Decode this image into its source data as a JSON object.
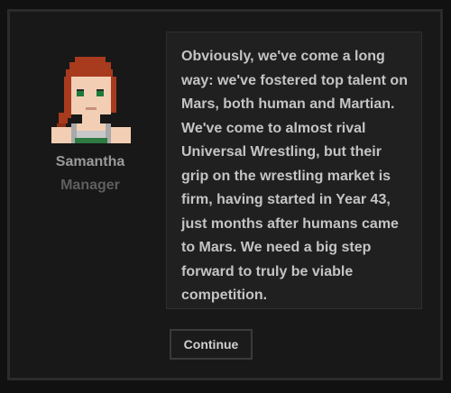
{
  "speaker": {
    "name": "Samantha",
    "role": "Manager",
    "portrait_icon": "pixel-portrait-icon"
  },
  "dialogue": {
    "text": "Obviously, we've come a long way: we've fostered top talent on Mars, both human and Martian. We've come to almost rival Universal Wrestling, but their grip on the wrestling market is firm, having started in Year 43, just months after humans came to Mars. We need a big step forward to truly be viable competition."
  },
  "actions": {
    "continue_label": "Continue"
  },
  "colors": {
    "background": "#111111",
    "panel": "#181818",
    "speech_box": "#202020",
    "text": "#c4c4c4",
    "name": "#9a9a9a",
    "role": "#5e5e5e",
    "hair": "#a83a1e",
    "skin": "#f2cfb4",
    "eyes": "#1f7a3a"
  }
}
